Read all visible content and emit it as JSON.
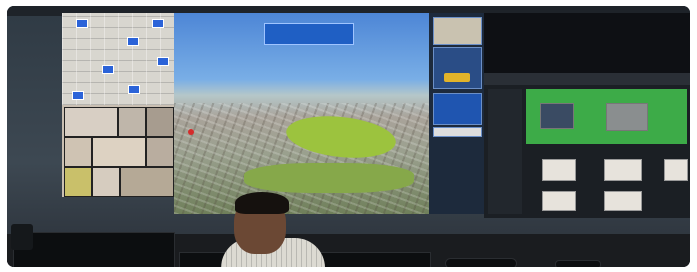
{
  "scene": {
    "subject": "",
    "aerial_banner_text": "",
    "list_rows": [
      "",
      "",
      "",
      ""
    ]
  }
}
